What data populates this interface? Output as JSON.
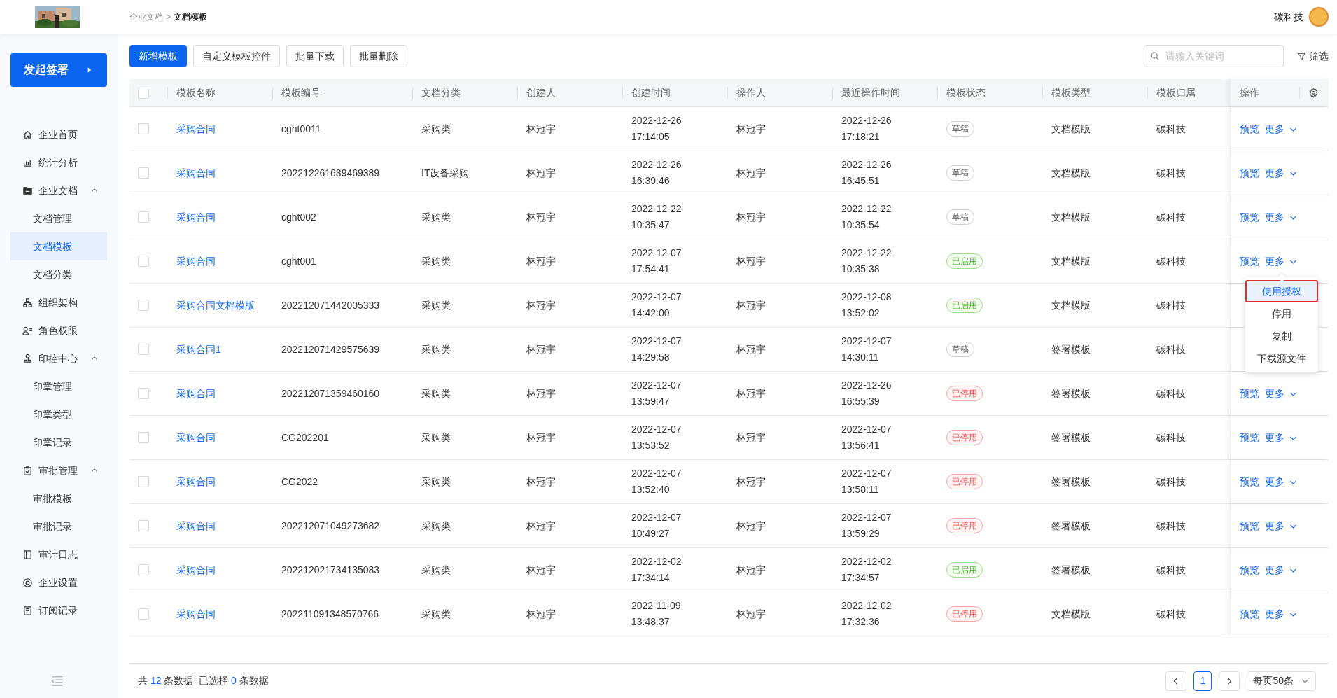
{
  "breadcrumb": {
    "parent": "企业文档",
    "separator": ">",
    "current": "文档模板"
  },
  "user": {
    "name": "碳科技"
  },
  "sign_button": "发起签署",
  "sidebar": {
    "items": [
      {
        "label": "企业首页",
        "selected": false
      },
      {
        "label": "统计分析",
        "selected": false
      },
      {
        "label": "企业文档",
        "selected": false,
        "expanded": true,
        "children": [
          {
            "label": "文档管理",
            "selected": false
          },
          {
            "label": "文档模板",
            "selected": true
          },
          {
            "label": "文档分类",
            "selected": false
          }
        ]
      },
      {
        "label": "组织架构",
        "selected": false
      },
      {
        "label": "角色权限",
        "selected": false
      },
      {
        "label": "印控中心",
        "selected": false,
        "expanded": true,
        "children": [
          {
            "label": "印章管理",
            "selected": false
          },
          {
            "label": "印章类型",
            "selected": false
          },
          {
            "label": "印章记录",
            "selected": false
          }
        ]
      },
      {
        "label": "审批管理",
        "selected": false,
        "expanded": true,
        "children": [
          {
            "label": "审批模板",
            "selected": false
          },
          {
            "label": "审批记录",
            "selected": false
          }
        ]
      },
      {
        "label": "审计日志",
        "selected": false
      },
      {
        "label": "企业设置",
        "selected": false
      },
      {
        "label": "订阅记录",
        "selected": false
      }
    ]
  },
  "toolbar": {
    "buttons": [
      {
        "label": "新增模板",
        "kind": "primary"
      },
      {
        "label": "自定义模板控件",
        "kind": "default"
      },
      {
        "label": "批量下载",
        "kind": "default"
      },
      {
        "label": "批量删除",
        "kind": "default"
      }
    ],
    "search": {
      "placeholder": "请输入关键词"
    },
    "filter": "筛选"
  },
  "table": {
    "select_all_checked": false,
    "columns": [
      "模板名称",
      "模板编号",
      "文档分类",
      "创建人",
      "创建时间",
      "操作人",
      "最近操作时间",
      "模板状态",
      "模板类型",
      "模板归属",
      "操作"
    ],
    "rows": [
      {
        "checked": false,
        "name": "采购合同",
        "code": "cght0011",
        "category": "采购类",
        "creator": "林冠宇",
        "created": [
          "2022-12-26",
          "17:14:05"
        ],
        "operator": "林冠宇",
        "last_op": [
          "2022-12-26",
          "17:18:21"
        ],
        "status": {
          "label": "草稿",
          "kind": "draft"
        },
        "type": "文档模版",
        "owner": "碳科技",
        "actions": {
          "preview": "预览",
          "more": "更多"
        }
      },
      {
        "checked": false,
        "name": "采购合同",
        "code": "202212261639469389",
        "category": "IT设备采购",
        "creator": "林冠宇",
        "created": [
          "2022-12-26",
          "16:39:46"
        ],
        "operator": "林冠宇",
        "last_op": [
          "2022-12-26",
          "16:45:51"
        ],
        "status": {
          "label": "草稿",
          "kind": "draft"
        },
        "type": "文档模版",
        "owner": "碳科技",
        "actions": {
          "preview": "预览",
          "more": "更多"
        }
      },
      {
        "checked": false,
        "name": "采购合同",
        "code": "cght002",
        "category": "采购类",
        "creator": "林冠宇",
        "created": [
          "2022-12-22",
          "10:35:47"
        ],
        "operator": "林冠宇",
        "last_op": [
          "2022-12-22",
          "10:35:54"
        ],
        "status": {
          "label": "草稿",
          "kind": "draft"
        },
        "type": "文档模版",
        "owner": "碳科技",
        "actions": {
          "preview": "预览",
          "more": "更多"
        }
      },
      {
        "checked": false,
        "name": "采购合同",
        "code": "cght001",
        "category": "采购类",
        "creator": "林冠宇",
        "created": [
          "2022-12-07",
          "17:54:41"
        ],
        "operator": "林冠宇",
        "last_op": [
          "2022-12-22",
          "10:35:38"
        ],
        "status": {
          "label": "已启用",
          "kind": "enabled"
        },
        "type": "文档模版",
        "owner": "碳科技",
        "actions": {
          "preview": "预览",
          "more": "更多"
        }
      },
      {
        "checked": false,
        "name": "采购合同文档模版",
        "code": "202212071442005333",
        "category": "采购类",
        "creator": "林冠宇",
        "created": [
          "2022-12-07",
          "14:42:00"
        ],
        "operator": "林冠宇",
        "last_op": [
          "2022-12-08",
          "13:52:02"
        ],
        "status": {
          "label": "已启用",
          "kind": "enabled"
        },
        "type": "文档模版",
        "owner": "碳科技"
      },
      {
        "checked": false,
        "name": "采购合同1",
        "code": "202212071429575639",
        "category": "采购类",
        "creator": "林冠宇",
        "created": [
          "2022-12-07",
          "14:29:58"
        ],
        "operator": "林冠宇",
        "last_op": [
          "2022-12-07",
          "14:30:11"
        ],
        "status": {
          "label": "草稿",
          "kind": "draft"
        },
        "type": "签署模板",
        "owner": "碳科技"
      },
      {
        "checked": false,
        "name": "采购合同",
        "code": "202212071359460160",
        "category": "采购类",
        "creator": "林冠宇",
        "created": [
          "2022-12-07",
          "13:59:47"
        ],
        "operator": "林冠宇",
        "last_op": [
          "2022-12-26",
          "16:55:39"
        ],
        "status": {
          "label": "已停用",
          "kind": "disabled"
        },
        "type": "签署模板",
        "owner": "碳科技",
        "actions": {
          "preview": "预览",
          "more": "更多"
        }
      },
      {
        "checked": false,
        "name": "采购合同",
        "code": "CG202201",
        "category": "采购类",
        "creator": "林冠宇",
        "created": [
          "2022-12-07",
          "13:53:52"
        ],
        "operator": "林冠宇",
        "last_op": [
          "2022-12-07",
          "13:56:41"
        ],
        "status": {
          "label": "已停用",
          "kind": "disabled"
        },
        "type": "签署模板",
        "owner": "碳科技",
        "actions": {
          "preview": "预览",
          "more": "更多"
        }
      },
      {
        "checked": false,
        "name": "采购合同",
        "code": "CG2022",
        "category": "采购类",
        "creator": "林冠宇",
        "created": [
          "2022-12-07",
          "13:52:40"
        ],
        "operator": "林冠宇",
        "last_op": [
          "2022-12-07",
          "13:58:11"
        ],
        "status": {
          "label": "已停用",
          "kind": "disabled"
        },
        "type": "签署模板",
        "owner": "碳科技",
        "actions": {
          "preview": "预览",
          "more": "更多"
        }
      },
      {
        "checked": false,
        "name": "采购合同",
        "code": "202212071049273682",
        "category": "采购类",
        "creator": "林冠宇",
        "created": [
          "2022-12-07",
          "10:49:27"
        ],
        "operator": "林冠宇",
        "last_op": [
          "2022-12-07",
          "13:59:29"
        ],
        "status": {
          "label": "已停用",
          "kind": "disabled"
        },
        "type": "签署模板",
        "owner": "碳科技",
        "actions": {
          "preview": "预览",
          "more": "更多"
        }
      },
      {
        "checked": false,
        "name": "采购合同",
        "code": "202212021734135083",
        "category": "采购类",
        "creator": "林冠宇",
        "created": [
          "2022-12-02",
          "17:34:14"
        ],
        "operator": "林冠宇",
        "last_op": [
          "2022-12-02",
          "17:34:57"
        ],
        "status": {
          "label": "已启用",
          "kind": "enabled"
        },
        "type": "签署模板",
        "owner": "碳科技",
        "actions": {
          "preview": "预览",
          "more": "更多"
        }
      },
      {
        "checked": false,
        "name": "采购合同",
        "code": "202211091348570766",
        "category": "采购类",
        "creator": "林冠宇",
        "created": [
          "2022-11-09",
          "13:48:37"
        ],
        "operator": "林冠宇",
        "last_op": [
          "2022-12-02",
          "17:32:36"
        ],
        "status": {
          "label": "已停用",
          "kind": "disabled"
        },
        "type": "文档模版",
        "owner": "碳科技",
        "actions": {
          "preview": "预览",
          "more": "更多"
        }
      }
    ]
  },
  "row_menu": {
    "items": [
      {
        "label": "使用授权",
        "selected": true
      },
      {
        "label": "停用",
        "selected": false
      },
      {
        "label": "复制",
        "selected": false
      },
      {
        "label": "下载源文件",
        "selected": false
      }
    ]
  },
  "footer": {
    "total_before": "共",
    "total": "12",
    "total_after": "条数据",
    "selected_before": "已选择",
    "selected": "0",
    "selected_after": "条数据"
  },
  "pagination": {
    "pages": [
      {
        "label": "1",
        "selected": true
      }
    ],
    "page_size": "每页50条"
  }
}
